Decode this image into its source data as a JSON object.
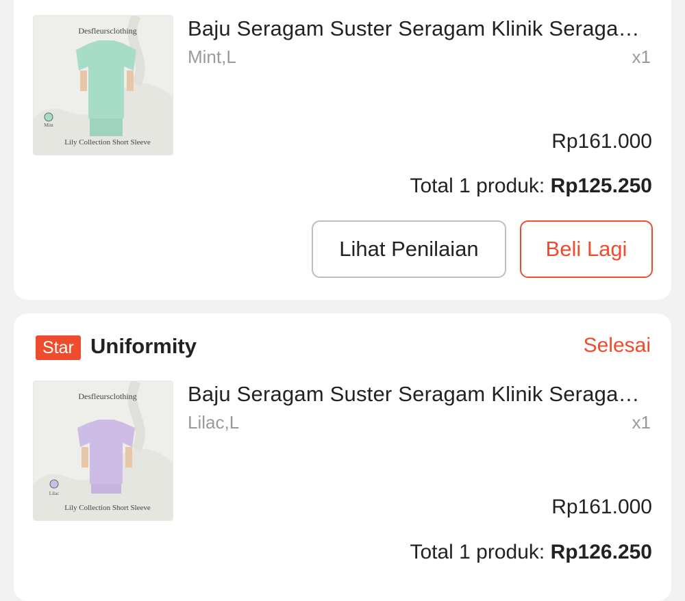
{
  "orders": [
    {
      "product": {
        "brand_watermark": "Desfleursclothing",
        "collection_caption": "Lily Collection Short Sleeve",
        "swatch_label": "Mint",
        "garment_color": "#a7dcc9",
        "name": "Baju Seragam Suster Seragam Klinik Seragam Perawat Lily Collection Short Sleeve",
        "variant": "Mint,L",
        "quantity": "x1",
        "price": "Rp161.000"
      },
      "total_label": "Total 1 produk: ",
      "total_value": "Rp125.250",
      "buttons": {
        "review": "Lihat Penilaian",
        "buy_again": "Beli Lagi"
      }
    },
    {
      "shop": {
        "badge": "Star",
        "name": "Uniformity"
      },
      "status": "Selesai",
      "product": {
        "brand_watermark": "Desfleursclothing",
        "collection_caption": "Lily Collection Short Sleeve",
        "swatch_label": "Lilac",
        "garment_color": "#cdbde6",
        "name": "Baju Seragam Suster Seragam Klinik Seragam Perawat Lily Collection Short Sleeve",
        "variant": "Lilac,L",
        "quantity": "x1",
        "price": "Rp161.000"
      },
      "total_label": "Total 1 produk: ",
      "total_value": "Rp126.250"
    }
  ],
  "colors": {
    "accent": "#ee4d2d",
    "background": "#f2f2f2",
    "card": "#ffffff"
  }
}
